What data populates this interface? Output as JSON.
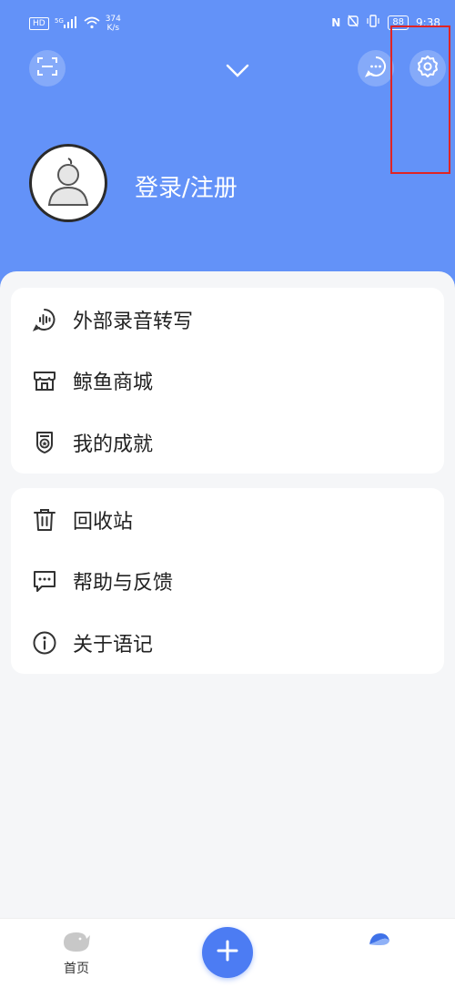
{
  "statusbar": {
    "net_chip": "HD",
    "signal_label": "5G",
    "speed_top": "374",
    "speed_bottom": "K/s",
    "nfc": "N",
    "battery": "88",
    "time": "9:38"
  },
  "header": {
    "login_label": "登录/注册"
  },
  "menu_group_1": [
    {
      "label": "外部录音转写",
      "icon": "voice-chat-icon"
    },
    {
      "label": "鲸鱼商城",
      "icon": "store-icon"
    },
    {
      "label": "我的成就",
      "icon": "badge-icon"
    }
  ],
  "menu_group_2": [
    {
      "label": "回收站",
      "icon": "trash-icon"
    },
    {
      "label": "帮助与反馈",
      "icon": "feedback-icon"
    },
    {
      "label": "关于语记",
      "icon": "info-icon"
    }
  ],
  "bottom_nav": {
    "home_label": "首页"
  },
  "colors": {
    "primary": "#6392f8",
    "fab": "#4c7cf3",
    "highlight": "#e02424"
  }
}
